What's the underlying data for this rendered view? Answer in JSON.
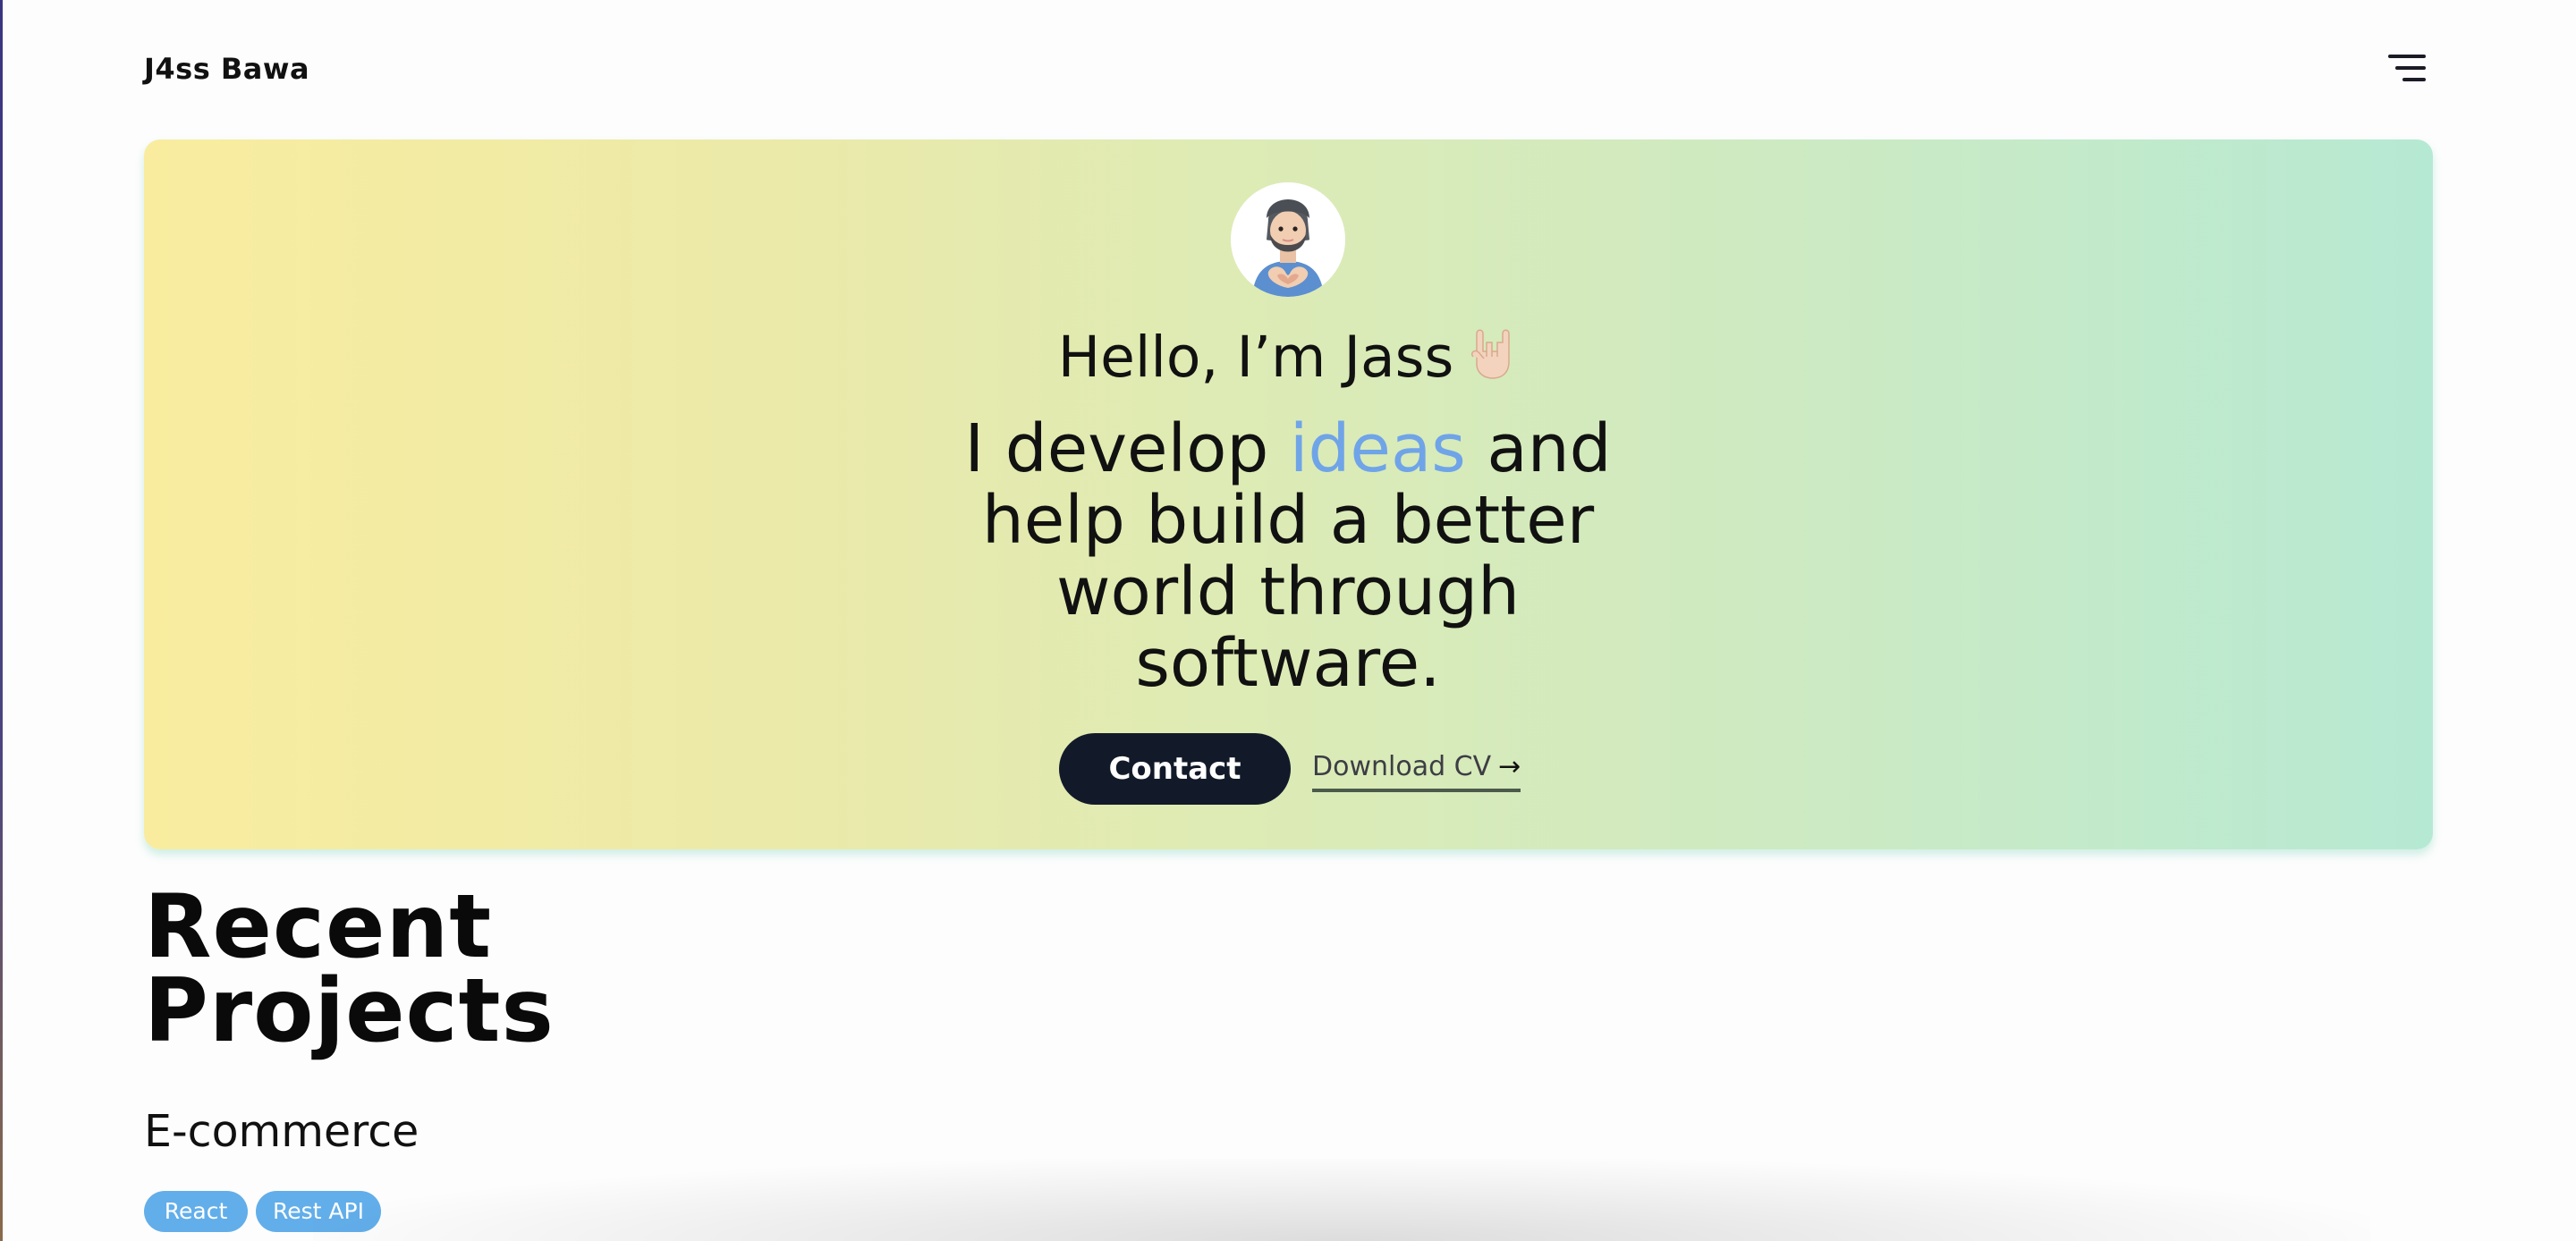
{
  "header": {
    "brand": "J4ss Bawa",
    "menu_icon": "hamburger-menu-icon"
  },
  "hero": {
    "avatar_icon": "memoji-avatar",
    "greeting": "Hello, I’m Jass",
    "greeting_icon": "rock-on-hand-emoji",
    "tagline": {
      "line1_prefix": "I develop ",
      "line1_accent": "ideas",
      "line1_suffix": " and",
      "line2": "help build a better",
      "line3": "world through",
      "line4": "software."
    },
    "contact_label": "Contact",
    "download_label": "Download CV",
    "download_arrow": "→",
    "colors": {
      "gradient_start": "#f9ec9f",
      "gradient_end": "#b6e9d3",
      "accent": "#6fa4e8",
      "button": "#121a2a"
    }
  },
  "projects": {
    "title_line1": "Recent",
    "title_line2": "Projects",
    "items": [
      {
        "title": "E-commerce",
        "tags": [
          "React",
          "Rest API"
        ],
        "tag_color": "#62aeea"
      }
    ]
  }
}
